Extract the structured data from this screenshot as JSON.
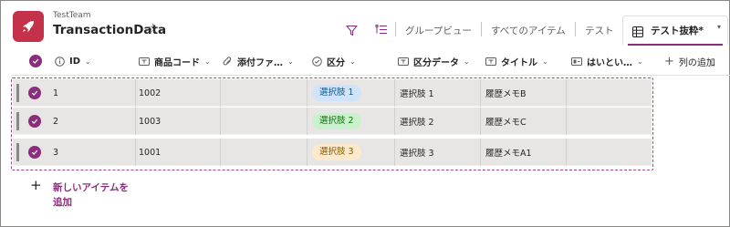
{
  "header": {
    "team": "TestTeam",
    "title": "TransactionData",
    "tabs": [
      "グループビュー",
      "すべてのアイテム",
      "テスト"
    ],
    "active_tab": "テスト抜粋*"
  },
  "columns": [
    {
      "label": "ID",
      "icon": "info-icon"
    },
    {
      "label": "商品コード",
      "icon": "text-field-icon"
    },
    {
      "label": "添付ファ…",
      "icon": "attachment-icon"
    },
    {
      "label": "区分",
      "icon": "choice-icon"
    },
    {
      "label": "区分データ",
      "icon": "text-field-icon"
    },
    {
      "label": "タイトル",
      "icon": "text-field-icon"
    },
    {
      "label": "はいとい…",
      "icon": "yes-no-icon"
    }
  ],
  "add_column_label": "列の追加",
  "rows": [
    {
      "id": "1",
      "code": "1002",
      "attachment": "",
      "category": "選択肢 1",
      "category_color": "#cfe4fa",
      "category_text_color": "#0f548c",
      "category_data": "選択肢 1",
      "title": "履歴メモB"
    },
    {
      "id": "2",
      "code": "1003",
      "attachment": "",
      "category": "選択肢 2",
      "category_color": "#caf0cc",
      "category_text_color": "#0e700e",
      "category_data": "選択肢 2",
      "title": "履歴メモC"
    },
    {
      "id": "3",
      "code": "1001",
      "attachment": "",
      "category": "選択肢 3",
      "category_color": "#fdeacc",
      "category_text_color": "#835b00",
      "category_data": "選択肢 3",
      "title": "履歴メモA1"
    }
  ],
  "add_item": {
    "line1": "新しいアイテムを",
    "line2": "追加"
  },
  "colors": {
    "accent": "#8b2d7d",
    "app_icon": "#c4314b"
  }
}
